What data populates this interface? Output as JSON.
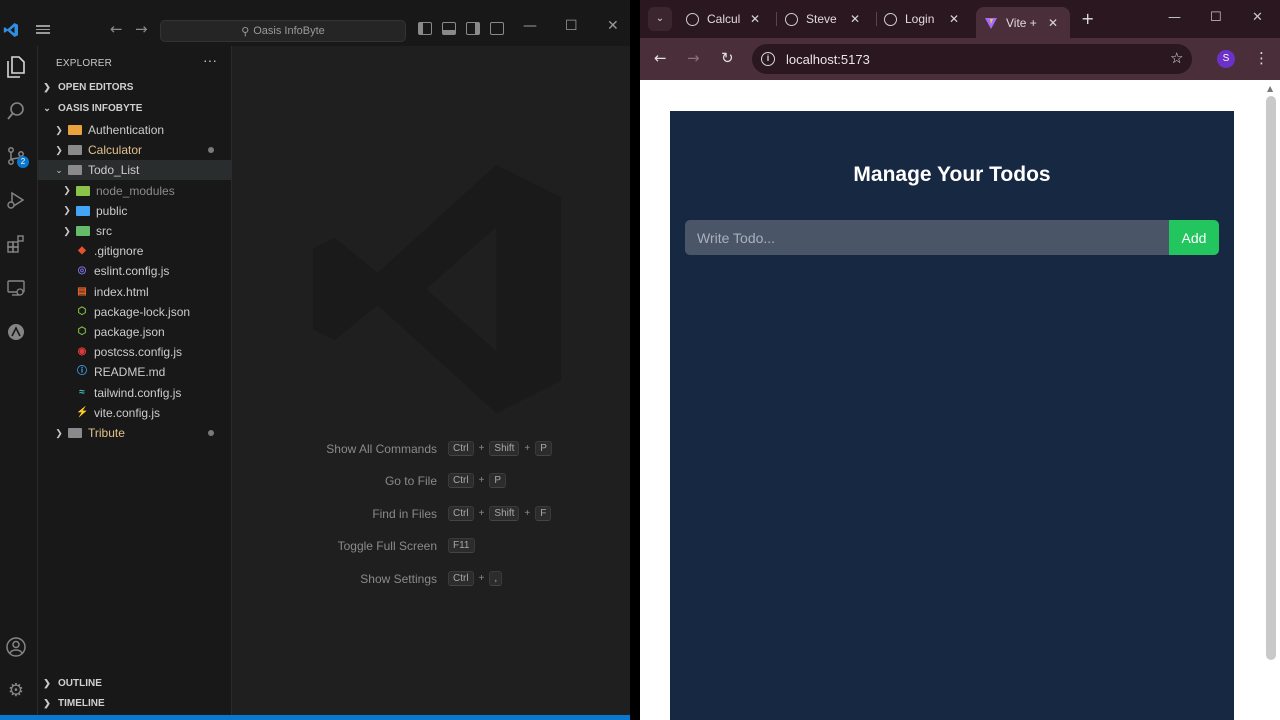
{
  "vscode": {
    "search_label": "Oasis InfoByte",
    "explorer_title": "EXPLORER",
    "sections": {
      "open_editors": "OPEN EDITORS",
      "workspace": "OASIS INFOBYTE",
      "outline": "OUTLINE",
      "timeline": "TIMELINE"
    },
    "scm_badge": "2",
    "tree": [
      {
        "label": "Authentication",
        "type": "folder",
        "color": "#e8a33d",
        "label_color": "#cccccc"
      },
      {
        "label": "Calculator",
        "type": "folder",
        "color": "#8a8a8a",
        "label_color": "#e2c08d"
      },
      {
        "label": "Todo_List",
        "type": "folder-open",
        "color": "#8a8a8a",
        "label_color": "#cccccc"
      },
      {
        "label": "node_modules",
        "type": "folder",
        "color": "#8bc34a",
        "label_color": "#8c8c8c"
      },
      {
        "label": "public",
        "type": "folder",
        "color": "#42a5f5",
        "label_color": "#cccccc"
      },
      {
        "label": "src",
        "type": "folder",
        "color": "#66bb6a",
        "label_color": "#cccccc"
      },
      {
        "label": ".gitignore",
        "type": "file",
        "icon": "git-icon",
        "color": "#e4532c",
        "label_color": "#cccccc"
      },
      {
        "label": "eslint.config.js",
        "type": "file",
        "icon": "eslint-icon",
        "color": "#7b6fdd",
        "label_color": "#cccccc"
      },
      {
        "label": "index.html",
        "type": "file",
        "icon": "html-icon",
        "color": "#e4632c",
        "label_color": "#cccccc"
      },
      {
        "label": "package-lock.json",
        "type": "file",
        "icon": "npm-icon",
        "color": "#8bc34a",
        "label_color": "#cccccc"
      },
      {
        "label": "package.json",
        "type": "file",
        "icon": "npm-icon",
        "color": "#8bc34a",
        "label_color": "#cccccc"
      },
      {
        "label": "postcss.config.js",
        "type": "file",
        "icon": "postcss-icon",
        "color": "#dd3a3a",
        "label_color": "#cccccc"
      },
      {
        "label": "README.md",
        "type": "file",
        "icon": "info-icon",
        "color": "#42a5f5",
        "label_color": "#cccccc"
      },
      {
        "label": "tailwind.config.js",
        "type": "file",
        "icon": "tailwind-icon",
        "color": "#44c2c7",
        "label_color": "#cccccc"
      },
      {
        "label": "vite.config.js",
        "type": "file",
        "icon": "vite-icon",
        "color": "#ffc531",
        "label_color": "#cccccc"
      },
      {
        "label": "Tribute",
        "type": "folder",
        "color": "#8a8a8a",
        "label_color": "#e2c08d"
      }
    ],
    "shortcuts": [
      {
        "label": "Show All Commands",
        "keys": [
          "Ctrl",
          "Shift",
          "P"
        ]
      },
      {
        "label": "Go to File",
        "keys": [
          "Ctrl",
          "P"
        ]
      },
      {
        "label": "Find in Files",
        "keys": [
          "Ctrl",
          "Shift",
          "F"
        ]
      },
      {
        "label": "Toggle Full Screen",
        "keys": [
          "F11"
        ]
      },
      {
        "label": "Show Settings",
        "keys": [
          "Ctrl",
          ","
        ]
      }
    ]
  },
  "browser": {
    "tabs": [
      {
        "title": "Calcul"
      },
      {
        "title": "Steve"
      },
      {
        "title": "Login"
      },
      {
        "title": "Vite +"
      }
    ],
    "url": "localhost:5173",
    "profile_initial": "S"
  },
  "app": {
    "title": "Manage Your Todos",
    "input_placeholder": "Write Todo...",
    "add_label": "Add",
    "colors": {
      "background": "#172842",
      "input": "#4b5568",
      "button": "#22c55e"
    }
  }
}
